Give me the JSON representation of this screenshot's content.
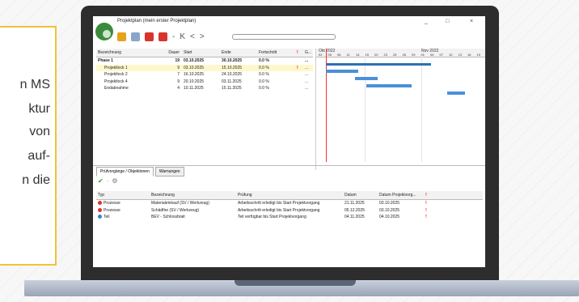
{
  "card": {
    "lines": [
      "n MS",
      "ktur",
      "von",
      "auf-",
      "n die"
    ]
  },
  "window": {
    "title": "Projektplan (mein erster Projektplan)",
    "minimize": "_",
    "maximize": "□",
    "close": "×"
  },
  "toolbar": {
    "prev": "K",
    "back": "<",
    "forward": ">",
    "dash": "-"
  },
  "table": {
    "headers": [
      "Bezeichnung",
      "Dauer",
      "Start",
      "Ende",
      "Fortschritt",
      "!",
      "G..."
    ],
    "rows": [
      {
        "name": "Phase 1",
        "dur": "19",
        "start": "03.10.2025",
        "end": "30.10.2025",
        "prog": "0.0 %",
        "warn": "",
        "g": "...",
        "bold": true
      },
      {
        "name": "Projektlock 1",
        "dur": "9",
        "start": "03.10.2025",
        "end": "15.10.2025",
        "prog": "0.0 %",
        "warn": "!",
        "g": "...",
        "sel": true
      },
      {
        "name": "Projektlock 2",
        "dur": "7",
        "start": "16.10.2025",
        "end": "24.10.2025",
        "prog": "0.0 %",
        "warn": "",
        "g": "..."
      },
      {
        "name": "Projektlock 4",
        "dur": "9",
        "start": "20.10.2025",
        "end": "03.11.2025",
        "prog": "0.0 %",
        "warn": "",
        "g": "..."
      },
      {
        "name": "Endabnahme",
        "dur": "4",
        "start": "10.11.2025",
        "end": "15.11.2025",
        "prog": "0.0 %",
        "warn": "",
        "g": "..."
      }
    ]
  },
  "gantt": {
    "month1": "Okt 2022",
    "month2": "Nov 2022",
    "days": [
      "02",
      "05",
      "06",
      "11",
      "14",
      "15",
      "20",
      "23",
      "25",
      "26",
      "29",
      "01",
      "04",
      "07",
      "10",
      "13",
      "16",
      "19"
    ]
  },
  "tabs": [
    "Prüfvorgänge / Objektionen",
    "Warnungen"
  ],
  "mini": {
    "ok": "✔",
    "sep": "·"
  },
  "lower": {
    "headers": [
      "Typ",
      "Bezeichnung",
      "Prüfung",
      "Datum",
      "Datum Projektvorg...",
      "!"
    ],
    "rows": [
      {
        "type": "Prozesse",
        "name": "Materialeinkauf (SV / Werkzeug)",
        "check": "Arbeitsschritt erledigt bis Start Projektvorgang",
        "date": "21.11.2025",
        "date2": "03.10.2025",
        "warn": "!",
        "color": "#d9342b"
      },
      {
        "type": "Prozesse",
        "name": "Schädfire (SV / Werkzeug)",
        "check": "Arbeitsschritt erledigt bis Start Projektvorgang",
        "date": "05.12.2025",
        "date2": "03.10.2025",
        "warn": "!",
        "color": "#d9342b"
      },
      {
        "type": "Teil",
        "name": "BEV - Schlossbrait",
        "check": "Teil verfügbar bis Start Projektvorgang",
        "date": "04.11.2025",
        "date2": "04.10.2025",
        "warn": "!",
        "color": "#3a7fd0"
      }
    ]
  },
  "colors": {
    "accent": "#f2c237",
    "bar": "#4a90d9",
    "laptop": "#2d2d2d",
    "logo": "#3b8b3d"
  }
}
